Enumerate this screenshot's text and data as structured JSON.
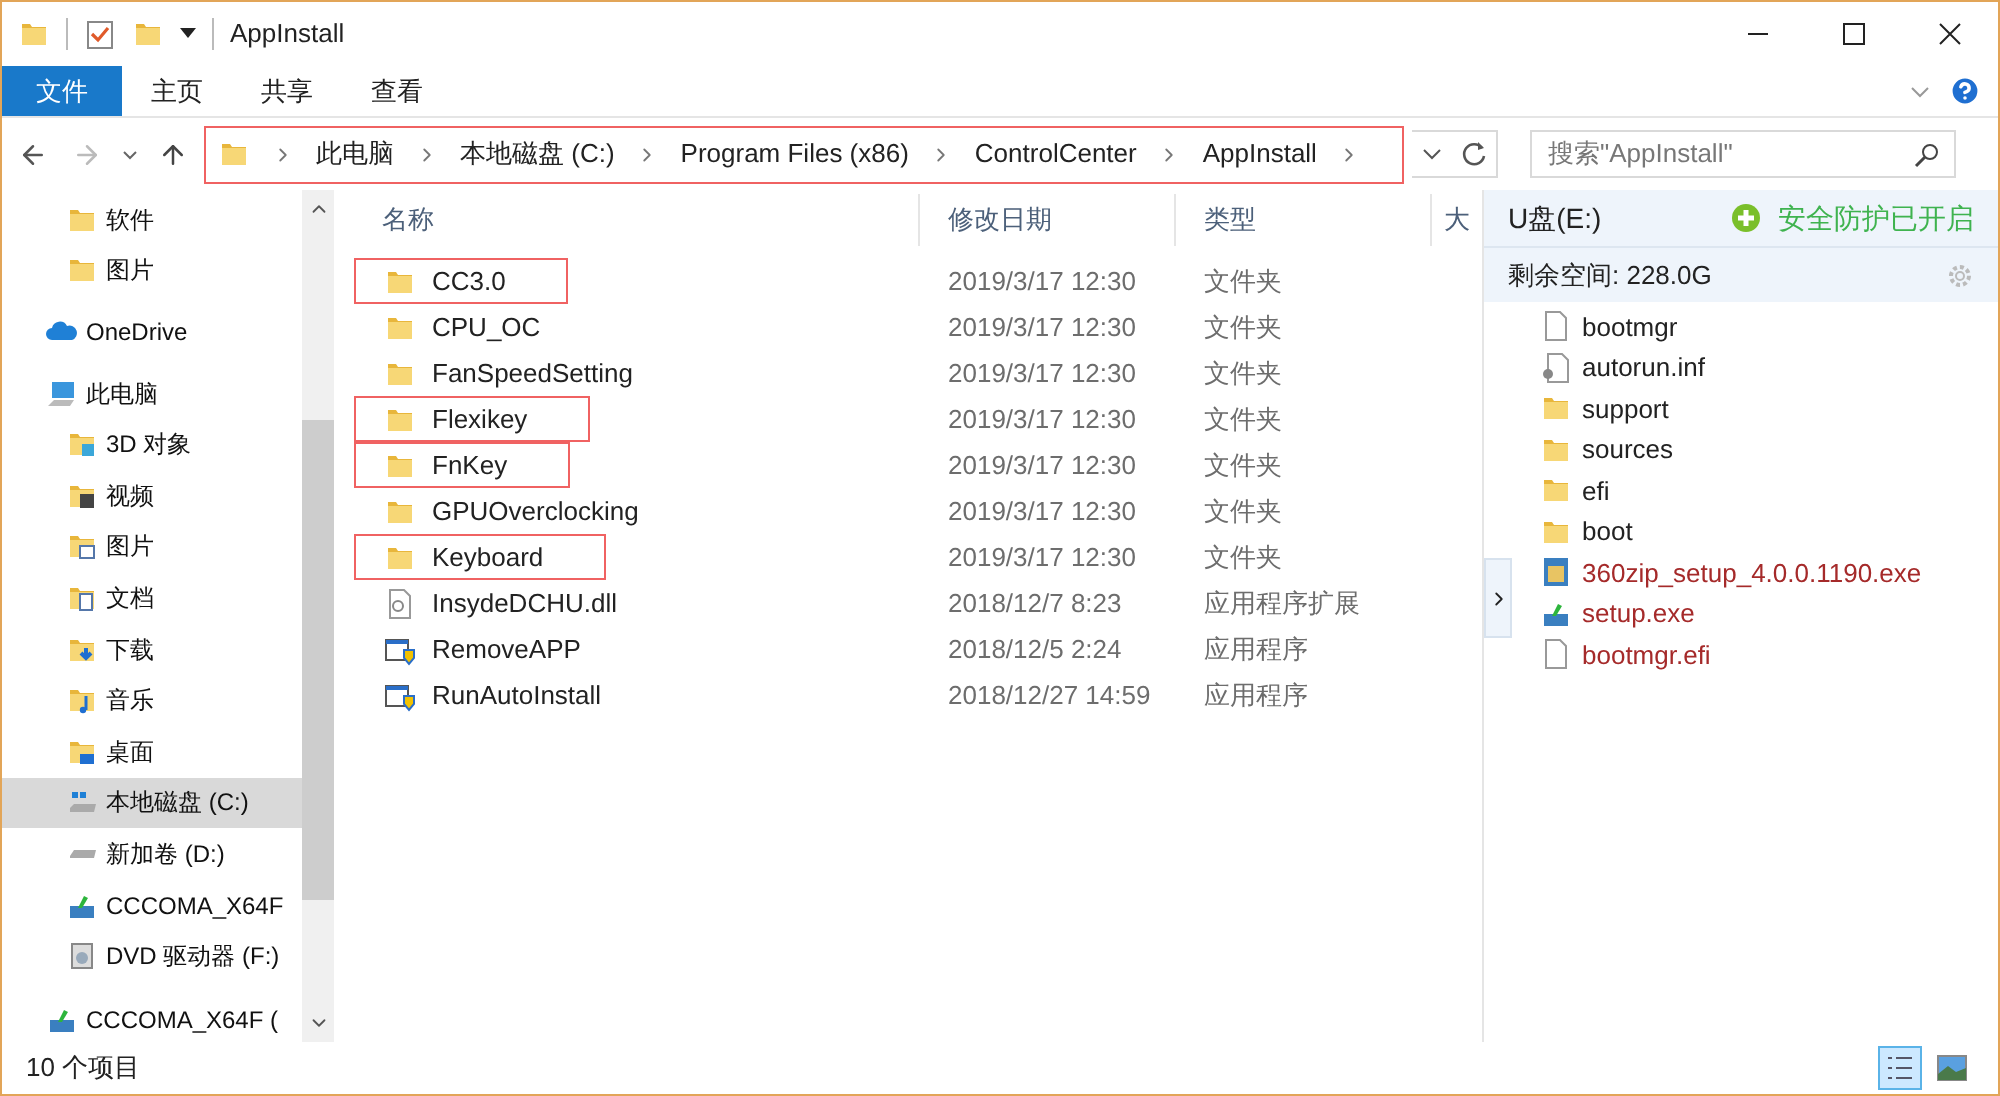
{
  "window": {
    "title": "AppInstall"
  },
  "ribbon_tabs": [
    {
      "label": "文件",
      "selected": true
    },
    {
      "label": "主页",
      "selected": false
    },
    {
      "label": "共享",
      "selected": false
    },
    {
      "label": "查看",
      "selected": false
    }
  ],
  "address_bar": {
    "highlighted": true,
    "crumbs": [
      "此电脑",
      "本地磁盘 (C:)",
      "Program Files (x86)",
      "ControlCenter",
      "AppInstall"
    ]
  },
  "search": {
    "placeholder": "搜索\"AppInstall\""
  },
  "sidebar": {
    "items": [
      {
        "label": "软件",
        "kind": "folder",
        "selected": false
      },
      {
        "label": "图片",
        "kind": "folder",
        "selected": false
      },
      {
        "label": "OneDrive",
        "kind": "cloud",
        "selected": false
      },
      {
        "label": "此电脑",
        "kind": "pc",
        "selected": false,
        "children": [
          {
            "label": "3D 对象",
            "kind": "objects",
            "selected": false
          },
          {
            "label": "视频",
            "kind": "video",
            "selected": false
          },
          {
            "label": "图片",
            "kind": "pictures",
            "selected": false
          },
          {
            "label": "文档",
            "kind": "docs",
            "selected": false
          },
          {
            "label": "下载",
            "kind": "downloads",
            "selected": false
          },
          {
            "label": "音乐",
            "kind": "music",
            "selected": false
          },
          {
            "label": "桌面",
            "kind": "desktop",
            "selected": false
          },
          {
            "label": "本地磁盘 (C:)",
            "kind": "windrive",
            "selected": true
          },
          {
            "label": "新加卷 (D:)",
            "kind": "drive",
            "selected": false
          },
          {
            "label": "CCCOMA_X64F",
            "kind": "setup",
            "selected": false
          },
          {
            "label": "DVD 驱动器 (F:)",
            "kind": "dvd",
            "selected": false
          }
        ]
      },
      {
        "label": "CCCOMA_X64F (",
        "kind": "setup",
        "selected": false
      }
    ]
  },
  "file_list": {
    "columns": [
      "名称",
      "修改日期",
      "类型",
      "大"
    ],
    "rows": [
      {
        "name": "CC3.0",
        "date": "2019/3/17 12:30",
        "type": "文件夹",
        "kind": "folder",
        "highlighted": true
      },
      {
        "name": "CPU_OC",
        "date": "2019/3/17 12:30",
        "type": "文件夹",
        "kind": "folder",
        "highlighted": false
      },
      {
        "name": "FanSpeedSetting",
        "date": "2019/3/17 12:30",
        "type": "文件夹",
        "kind": "folder",
        "highlighted": false
      },
      {
        "name": "Flexikey",
        "date": "2019/3/17 12:30",
        "type": "文件夹",
        "kind": "folder",
        "highlighted": true
      },
      {
        "name": "FnKey",
        "date": "2019/3/17 12:30",
        "type": "文件夹",
        "kind": "folder",
        "highlighted": true
      },
      {
        "name": "GPUOverclocking",
        "date": "2019/3/17 12:30",
        "type": "文件夹",
        "kind": "folder",
        "highlighted": false
      },
      {
        "name": "Keyboard",
        "date": "2019/3/17 12:30",
        "type": "文件夹",
        "kind": "folder",
        "highlighted": true
      },
      {
        "name": "InsydeDCHU.dll",
        "date": "2018/12/7 8:23",
        "type": "应用程序扩展",
        "kind": "dll",
        "highlighted": false
      },
      {
        "name": "RemoveAPP",
        "date": "2018/12/5 2:24",
        "type": "应用程序",
        "kind": "app",
        "highlighted": false
      },
      {
        "name": "RunAutoInstall",
        "date": "2018/12/27 14:59",
        "type": "应用程序",
        "kind": "app",
        "highlighted": false
      }
    ]
  },
  "usb_panel": {
    "title": "U盘(E:)",
    "protection": "安全防护已开启",
    "free_space": "剩余空间: 228.0G",
    "files": [
      {
        "name": "bootmgr",
        "kind": "file",
        "color": "#222222"
      },
      {
        "name": "autorun.inf",
        "kind": "inf",
        "color": "#222222"
      },
      {
        "name": "support",
        "kind": "folder",
        "color": "#222222"
      },
      {
        "name": "sources",
        "kind": "folder",
        "color": "#222222"
      },
      {
        "name": "efi",
        "kind": "folder",
        "color": "#222222"
      },
      {
        "name": "boot",
        "kind": "folder",
        "color": "#222222"
      },
      {
        "name": "360zip_setup_4.0.0.1190.exe",
        "kind": "installer",
        "color": "#a52a2a"
      },
      {
        "name": "setup.exe",
        "kind": "setup",
        "color": "#a52a2a"
      },
      {
        "name": "bootmgr.efi",
        "kind": "file",
        "color": "#a52a2a"
      }
    ]
  },
  "status_bar": {
    "count": "10 个项目",
    "views": [
      {
        "kind": "details",
        "selected": true
      },
      {
        "kind": "tiles",
        "selected": false
      }
    ]
  }
}
